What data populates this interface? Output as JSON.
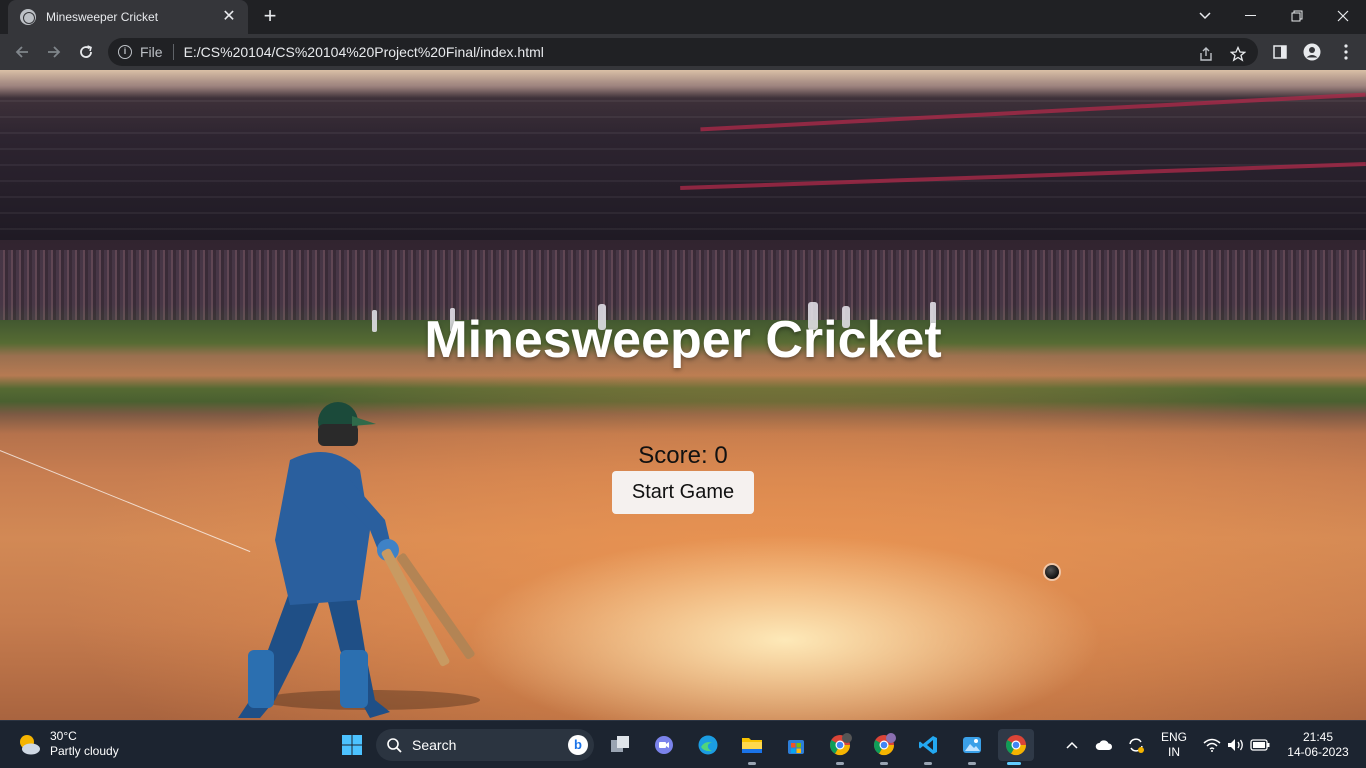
{
  "browser": {
    "tab_title": "Minesweeper Cricket",
    "omnibox_scheme": "File",
    "url": "E:/CS%20104/CS%20104%20Project%20Final/index.html"
  },
  "page": {
    "title": "Minesweeper Cricket",
    "score_label": "Score: 0",
    "start_button": "Start Game"
  },
  "taskbar": {
    "weather_temp": "30°C",
    "weather_desc": "Partly cloudy",
    "search_label": "Search",
    "lang_top": "ENG",
    "lang_bottom": "IN",
    "time": "21:45",
    "date": "14-06-2023",
    "apps": [
      "start-icon",
      "search",
      "task-view-icon",
      "meet-icon",
      "edge-icon",
      "file-explorer-icon",
      "store-icon",
      "chrome-profile-s-icon",
      "chrome-profile-2-icon",
      "vscode-icon",
      "photos-icon",
      "chrome-icon"
    ]
  },
  "colors": {
    "chrome_dark": "#202124",
    "chrome_toolbar": "#35363a",
    "taskbar": "#1c2430",
    "accent": "#60cdff"
  }
}
